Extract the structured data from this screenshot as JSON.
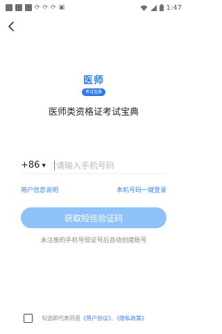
{
  "status_bar": {
    "time": "1:47",
    "left_icons": [
      "square-icon",
      "square-icon",
      "square-icon",
      "sync-icon",
      "sync-icon",
      "sync-icon",
      "image-icon"
    ],
    "right_icons": [
      "wifi-icon",
      "signal-icon",
      "battery-icon"
    ]
  },
  "header": {
    "back_icon": "back-arrow-icon"
  },
  "logo": {
    "main_text": "医师",
    "badge_text": "考试宝典"
  },
  "app_title": "医师类资格证考试宝典",
  "phone": {
    "country_code": "+86",
    "placeholder": "请输入手机号码",
    "value": ""
  },
  "links": {
    "user_info": "用户信息说明",
    "one_click_login": "本机号码一键登录"
  },
  "sms_button": {
    "label": "获取短信验证码"
  },
  "hint": "未注册的手机号验证号后自动创建账号",
  "agreement": {
    "checked": false,
    "prefix": "勾选即代表同意",
    "user_agreement": "《用户协议》",
    "separator": "、",
    "privacy_policy": "《隐私政策》"
  },
  "colors": {
    "accent": "#3b82f6",
    "logo_blue": "#2f7be8",
    "button_disabled": "#8ec2f8",
    "hint_text": "#888888"
  }
}
